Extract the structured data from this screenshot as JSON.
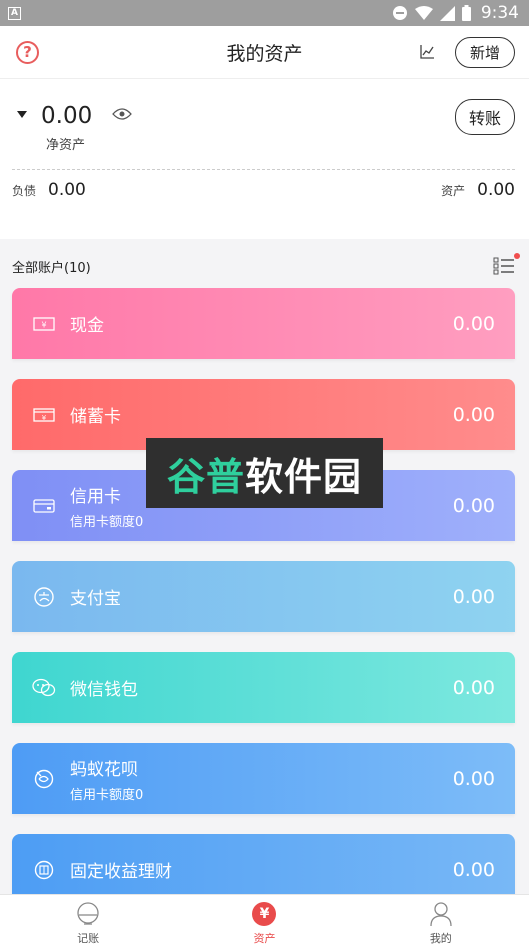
{
  "status_bar": {
    "time": "9:34",
    "left_badge": "A"
  },
  "header": {
    "title": "我的资产",
    "add_label": "新增"
  },
  "summary": {
    "net_value": "0.00",
    "net_label": "净资产",
    "transfer_label": "转账",
    "liability_label": "负债",
    "liability_value": "0.00",
    "asset_label": "资产",
    "asset_value": "0.00"
  },
  "accounts_section": {
    "title": "全部账户(10)"
  },
  "accounts": [
    {
      "name": "现金",
      "sub": "",
      "amount": "0.00",
      "icon": "cash-icon",
      "gradient": [
        "#ff78a8",
        "#ff9ec0"
      ]
    },
    {
      "name": "储蓄卡",
      "sub": "",
      "amount": "0.00",
      "icon": "savings-card-icon",
      "gradient": [
        "#ff6a6a",
        "#ff8c8c"
      ]
    },
    {
      "name": "信用卡",
      "sub": "信用卡额度0",
      "amount": "0.00",
      "icon": "credit-card-icon",
      "gradient": [
        "#7f8ff5",
        "#9fb0fb"
      ]
    },
    {
      "name": "支付宝",
      "sub": "",
      "amount": "0.00",
      "icon": "alipay-icon",
      "gradient": [
        "#7ab8ef",
        "#8fd3f0"
      ]
    },
    {
      "name": "微信钱包",
      "sub": "",
      "amount": "0.00",
      "icon": "wechat-icon",
      "gradient": [
        "#3fd6d0",
        "#7de8df"
      ]
    },
    {
      "name": "蚂蚁花呗",
      "sub": "信用卡额度0",
      "amount": "0.00",
      "icon": "huabei-icon",
      "gradient": [
        "#4e9cf5",
        "#7dbcf8"
      ]
    },
    {
      "name": "固定收益理财",
      "sub": "",
      "amount": "0.00",
      "icon": "fixed-income-icon",
      "gradient": [
        "#4d9df4",
        "#78b8f6"
      ]
    }
  ],
  "watermark": {
    "part1": "谷普",
    "part2": "软件",
    "part3": "园"
  },
  "tabbar": {
    "tabs": [
      {
        "label": "记账"
      },
      {
        "label": "资产"
      },
      {
        "label": "我的"
      }
    ]
  }
}
